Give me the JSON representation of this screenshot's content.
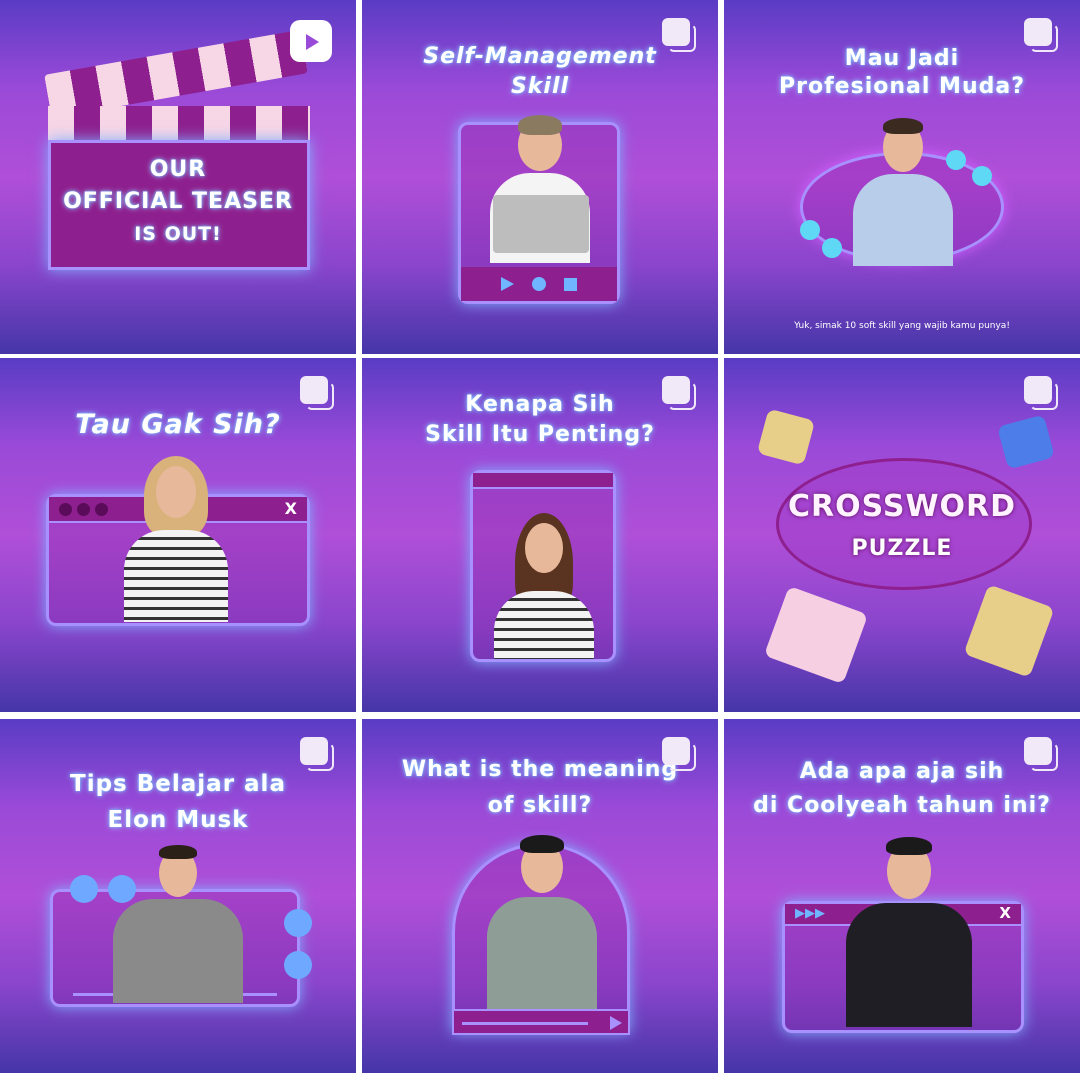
{
  "tiles": [
    {
      "type": "reel",
      "icon": "reels-icon",
      "lines": [
        "OUR",
        "OFFICIAL TEASER",
        "IS OUT!"
      ]
    },
    {
      "type": "carousel",
      "icon": "carousel-icon",
      "lines": [
        "Self-Management",
        "Skill"
      ]
    },
    {
      "type": "carousel",
      "icon": "carousel-icon",
      "lines": [
        "Mau Jadi",
        "Profesional Muda?"
      ],
      "caption": "Yuk, simak 10 soft skill yang wajib kamu punya!"
    },
    {
      "type": "carousel",
      "icon": "carousel-icon",
      "lines": [
        "Tau Gak Sih?"
      ],
      "close": "X"
    },
    {
      "type": "carousel",
      "icon": "carousel-icon",
      "lines": [
        "Kenapa Sih",
        "Skill Itu Penting?"
      ]
    },
    {
      "type": "carousel",
      "icon": "carousel-icon",
      "lines": [
        "CROSSWORD",
        "PUZZLE"
      ]
    },
    {
      "type": "carousel",
      "icon": "carousel-icon",
      "lines": [
        "Tips Belajar ala",
        "Elon Musk"
      ]
    },
    {
      "type": "carousel",
      "icon": "carousel-icon",
      "lines": [
        "What is the meaning",
        "of skill?"
      ]
    },
    {
      "type": "carousel",
      "icon": "carousel-icon",
      "lines": [
        "Ada apa aja sih",
        "di Coolyeah tahun ini?"
      ],
      "close": "X"
    }
  ],
  "colors": {
    "accent_glow": "#7fb0ff",
    "frame": "#a990ff",
    "clapper": "#8e1f8e",
    "dots": "#5fd8f5"
  }
}
